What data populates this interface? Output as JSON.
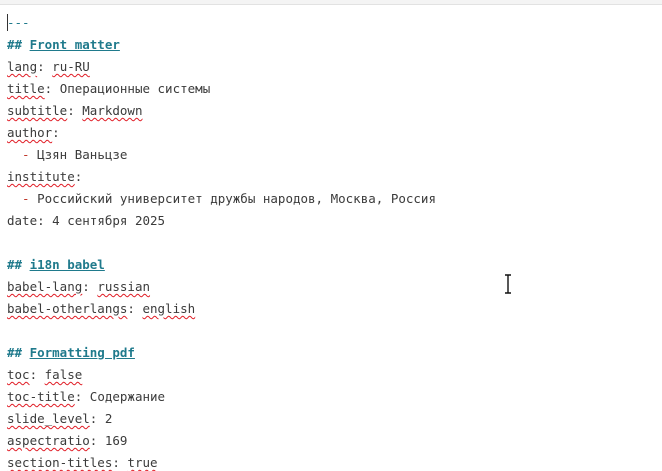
{
  "editor": {
    "lines": [
      {
        "type": "delim",
        "text": "---"
      },
      {
        "type": "heading",
        "marker": "## ",
        "text": "Front matter"
      },
      {
        "type": "kv",
        "key": "lang",
        "sep": ": ",
        "value": "ru-RU",
        "key_squiggle": true,
        "value_squiggle": true
      },
      {
        "type": "kv",
        "key": "title",
        "sep": ": ",
        "value": "Операционные системы",
        "key_squiggle": true,
        "value_squiggle": false
      },
      {
        "type": "kv",
        "key": "subtitle",
        "sep": ": ",
        "value": "Markdown",
        "key_squiggle": true,
        "value_squiggle": true
      },
      {
        "type": "kv",
        "key": "author",
        "sep": ":",
        "value": "",
        "key_squiggle": true,
        "value_squiggle": false
      },
      {
        "type": "item",
        "bullet": "  - ",
        "value": "Цзян Ваньцзе"
      },
      {
        "type": "kv",
        "key": "institute",
        "sep": ":",
        "value": "",
        "key_squiggle": true,
        "value_squiggle": false
      },
      {
        "type": "item",
        "bullet": "  - ",
        "value": "Российский университет дружбы народов, Москва, Россия"
      },
      {
        "type": "kv",
        "key": "date",
        "sep": ": ",
        "value": "4 сентября 2025",
        "key_squiggle": false,
        "value_squiggle": false
      },
      {
        "type": "blank",
        "text": ""
      },
      {
        "type": "heading",
        "marker": "## ",
        "text": "i18n babel"
      },
      {
        "type": "kv",
        "key": "babel-lang",
        "sep": ": ",
        "value": "russian",
        "key_squiggle": true,
        "value_squiggle": true
      },
      {
        "type": "kv",
        "key": "babel-otherlangs",
        "sep": ": ",
        "value": "english",
        "key_squiggle": true,
        "value_squiggle": true
      },
      {
        "type": "blank",
        "text": ""
      },
      {
        "type": "heading",
        "marker": "## ",
        "text": "Formatting pdf"
      },
      {
        "type": "kv",
        "key": "toc",
        "sep": ": ",
        "value": "false",
        "key_squiggle": true,
        "value_squiggle": true
      },
      {
        "type": "kv",
        "key": "toc-title",
        "sep": ": ",
        "value": "Содержание",
        "key_squiggle": true,
        "value_squiggle": false
      },
      {
        "type": "kv",
        "key": "slide_level",
        "sep": ": ",
        "value": "2",
        "key_squiggle": true,
        "value_squiggle": false
      },
      {
        "type": "kv",
        "key": "aspectratio",
        "sep": ": ",
        "value": "169",
        "key_squiggle": true,
        "value_squiggle": false
      },
      {
        "type": "kv",
        "key": "section-titles",
        "sep": ": ",
        "value": "true",
        "key_squiggle": true,
        "value_squiggle": true
      }
    ]
  },
  "colors": {
    "heading": "#1f7a8c",
    "spell_squiggle": "#e01b24",
    "text": "#3b3b3b",
    "bullet": "#c0392b"
  }
}
